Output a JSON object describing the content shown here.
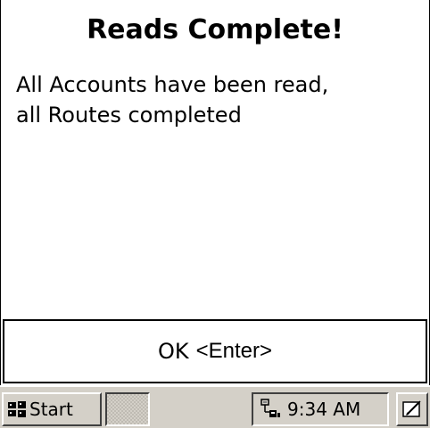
{
  "dialog": {
    "title": "Reads Complete!",
    "message_line1": "All Accounts have been read,",
    "message_line2": "all Routes completed",
    "ok_label": "OK",
    "ok_hint": "<Enter>"
  },
  "taskbar": {
    "start_label": "Start",
    "start_icon": "windows-flag-icon",
    "input_panel_icon": "input-panel-icon",
    "network_icon": "network-connection-icon",
    "clock": "9:34 AM",
    "sip_icon": "stylus-keyboard-icon"
  },
  "colors": {
    "background": "#ffffff",
    "taskbar": "#d4d0c8",
    "text": "#000000"
  }
}
